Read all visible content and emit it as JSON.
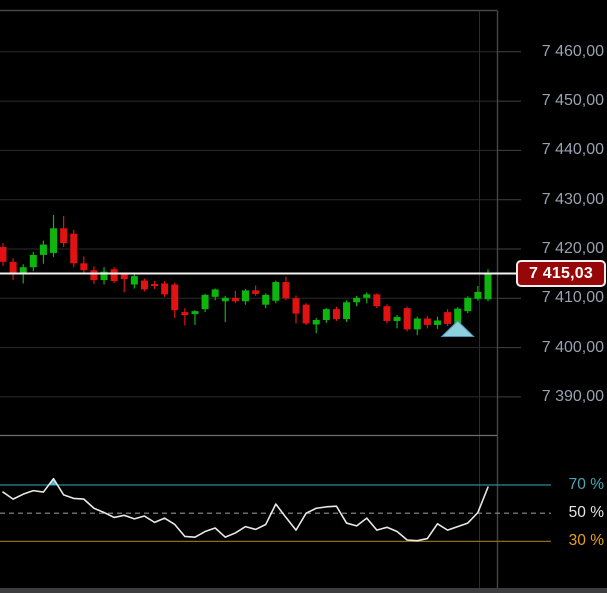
{
  "colors": {
    "background": "#000000",
    "bullish": "#0db50d",
    "bearish": "#e01212",
    "grid": "#2c2c2c",
    "grid_tick": "#424242",
    "border": "#464646",
    "panel_separator": "#6e6e6e",
    "axis_label": "#98a2b0",
    "last_price_line": "#f2f2f2",
    "last_price_tag_bg": "#970707",
    "last_price_tag_border": "#f0f0f0",
    "last_price_tag_text": "#ffffff",
    "oscillator_line": "#e8e8e8",
    "overbought_label": "#4aa7b5",
    "overbought_line": "#2f8899",
    "overbought_fill": "#52b7c8",
    "midline_label": "#e6e6e6",
    "midline_line": "#8f8f8f",
    "oversold_label": "#e8a01c",
    "oversold_line": "#8f6a1a",
    "signal_marker": "#8ed0e0",
    "signal_marker_border": "#4e95aa",
    "bottom_bar": "#3d3d40"
  },
  "price_axis": {
    "labels": [
      {
        "value": 7460,
        "label": "7 460,00"
      },
      {
        "value": 7450,
        "label": "7 450,00"
      },
      {
        "value": 7440,
        "label": "7 440,00"
      },
      {
        "value": 7430,
        "label": "7 430,00"
      },
      {
        "value": 7420,
        "label": "7 420,00"
      },
      {
        "value": 7410,
        "label": "7 410,00"
      },
      {
        "value": 7400,
        "label": "7 400,00"
      },
      {
        "value": 7390,
        "label": "7 390,00"
      }
    ],
    "last_price": 7415.03,
    "last_price_label": "7 415,03"
  },
  "oscillator_axis": {
    "levels": [
      {
        "value": 70,
        "label": "70 %"
      },
      {
        "value": 50,
        "label": "50 %"
      },
      {
        "value": 30,
        "label": "30 %"
      }
    ]
  },
  "chart_data": {
    "type": "candlestick",
    "title": "",
    "price_ylim": [
      7381.5,
      7468.5
    ],
    "grid_levels": [
      7460,
      7450,
      7440,
      7430,
      7420,
      7410,
      7400,
      7390
    ],
    "last_price": 7415.03,
    "candles_ohlc": [
      [
        7420.4,
        7421.2,
        7416.6,
        7417.4
      ],
      [
        7417.4,
        7418.1,
        7413.7,
        7414.9
      ],
      [
        7414.9,
        7416.9,
        7413.0,
        7416.3
      ],
      [
        7416.3,
        7419.4,
        7415.5,
        7418.8
      ],
      [
        7418.8,
        7421.7,
        7417.0,
        7420.9
      ],
      [
        7419.2,
        7426.9,
        7418.4,
        7424.2
      ],
      [
        7424.2,
        7426.7,
        7420.4,
        7421.2
      ],
      [
        7423.1,
        7423.9,
        7416.3,
        7417.1
      ],
      [
        7417.1,
        7418.5,
        7414.9,
        7415.7
      ],
      [
        7415.7,
        7416.5,
        7412.9,
        7413.7
      ],
      [
        7413.7,
        7416.3,
        7412.8,
        7415.4
      ],
      [
        7415.9,
        7416.3,
        7413.1,
        7413.5
      ],
      [
        7414.9,
        7415.2,
        7411.2,
        7413.9
      ],
      [
        7412.8,
        7414.9,
        7412.0,
        7414.5
      ],
      [
        7413.6,
        7414.0,
        7411.4,
        7411.8
      ],
      [
        7412.9,
        7413.5,
        7411.9,
        7412.5
      ],
      [
        7413.0,
        7413.5,
        7410.3,
        7410.8
      ],
      [
        7412.8,
        7413.2,
        7406.0,
        7407.6
      ],
      [
        7407.2,
        7408.0,
        7404.5,
        7406.6
      ],
      [
        7406.8,
        7407.6,
        7404.6,
        7407.4
      ],
      [
        7407.8,
        7410.9,
        7407.2,
        7410.7
      ],
      [
        7410.3,
        7412.0,
        7409.6,
        7411.8
      ],
      [
        7409.4,
        7410.5,
        7405.2,
        7410.1
      ],
      [
        7410.1,
        7411.5,
        7409.0,
        7409.4
      ],
      [
        7409.4,
        7411.9,
        7408.7,
        7411.6
      ],
      [
        7411.6,
        7412.6,
        7410.5,
        7410.9
      ],
      [
        7408.7,
        7411.0,
        7408.0,
        7410.7
      ],
      [
        7409.5,
        7413.6,
        7409.0,
        7413.3
      ],
      [
        7413.3,
        7414.4,
        7409.6,
        7410.0
      ],
      [
        7410.0,
        7410.6,
        7404.9,
        7406.9
      ],
      [
        7408.7,
        7409.0,
        7404.6,
        7404.9
      ],
      [
        7404.7,
        7406.0,
        7402.9,
        7405.6
      ],
      [
        7405.6,
        7408.0,
        7405.0,
        7407.8
      ],
      [
        7407.8,
        7408.3,
        7405.4,
        7405.8
      ],
      [
        7405.8,
        7409.6,
        7405.2,
        7409.2
      ],
      [
        7409.2,
        7410.5,
        7408.4,
        7410.1
      ],
      [
        7410.1,
        7411.2,
        7409.0,
        7410.8
      ],
      [
        7410.8,
        7411.0,
        7408.0,
        7408.4
      ],
      [
        7408.4,
        7408.8,
        7404.9,
        7405.4
      ],
      [
        7405.4,
        7406.6,
        7403.9,
        7406.2
      ],
      [
        7408.0,
        7408.3,
        7403.3,
        7403.7
      ],
      [
        7403.7,
        7406.3,
        7402.5,
        7405.9
      ],
      [
        7405.9,
        7406.4,
        7403.9,
        7404.6
      ],
      [
        7404.6,
        7406.3,
        7403.8,
        7405.5
      ],
      [
        7407.2,
        7407.8,
        7404.4,
        7404.8
      ],
      [
        7404.8,
        7408.2,
        7404.2,
        7407.9
      ],
      [
        7407.4,
        7410.4,
        7407.0,
        7410.1
      ],
      [
        7409.9,
        7412.5,
        7409.5,
        7411.3
      ],
      [
        7409.8,
        7415.9,
        7409.4,
        7415.1
      ]
    ],
    "signal_marker": {
      "type": "triangle-up",
      "candle_index": 45
    },
    "oscillator": {
      "type": "line",
      "ylim": [
        0,
        100
      ],
      "levels": [
        70,
        50,
        30
      ],
      "values": [
        65,
        60,
        63.5,
        66,
        65,
        74.5,
        63,
        60.5,
        60,
        53.5,
        50.5,
        47,
        48.5,
        46,
        48,
        43.5,
        46.5,
        42,
        33.5,
        33,
        37,
        39.5,
        33,
        36,
        40.5,
        38.5,
        42,
        56.5,
        47,
        38,
        50,
        53.5,
        54.5,
        55,
        43,
        41,
        46.5,
        38,
        40,
        37,
        31,
        30.5,
        32,
        42.5,
        38,
        40.5,
        43,
        50.5,
        68.5
      ]
    }
  }
}
